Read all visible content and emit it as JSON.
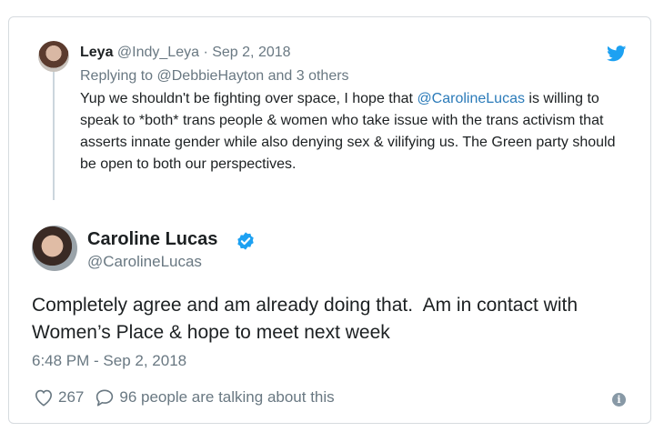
{
  "quoted_tweet": {
    "author_name": "Leya",
    "author_handle": "@Indy_Leya",
    "separator": "·",
    "date": "Sep 2, 2018",
    "replying_prefix": "Replying to",
    "replying_to": "@DebbieHayton",
    "replying_suffix": "and 3 others",
    "body_part1": "Yup we shouldn't be fighting over space, I hope that",
    "body_mention": "@CarolineLucas",
    "body_part2": "is willing to speak to *both* trans people & women who take issue with the trans activism that asserts innate gender while also denying sex & vilifying us. The Green party should be open to both our perspectives."
  },
  "main_tweet": {
    "author_name": "Caroline Lucas",
    "author_handle": "@CarolineLucas",
    "verified": true,
    "text_line1": "Completely agree and am already doing that.  Am in contact with",
    "text_line2": "Women’s Place & hope to meet next week",
    "timestamp": "6:48 PM - Sep 2, 2018"
  },
  "actions": {
    "likes_count": "267",
    "talking_text": "96 people are talking about this"
  },
  "icons": {
    "brand": "twitter-bird-icon",
    "verified": "verified-badge-icon",
    "like": "heart-icon",
    "reply": "speech-bubble-icon",
    "info": "info-icon"
  },
  "colors": {
    "brand": "#1da1f2",
    "link": "#2b7bb9",
    "muted": "#697882",
    "border": "#d6dbdf"
  }
}
